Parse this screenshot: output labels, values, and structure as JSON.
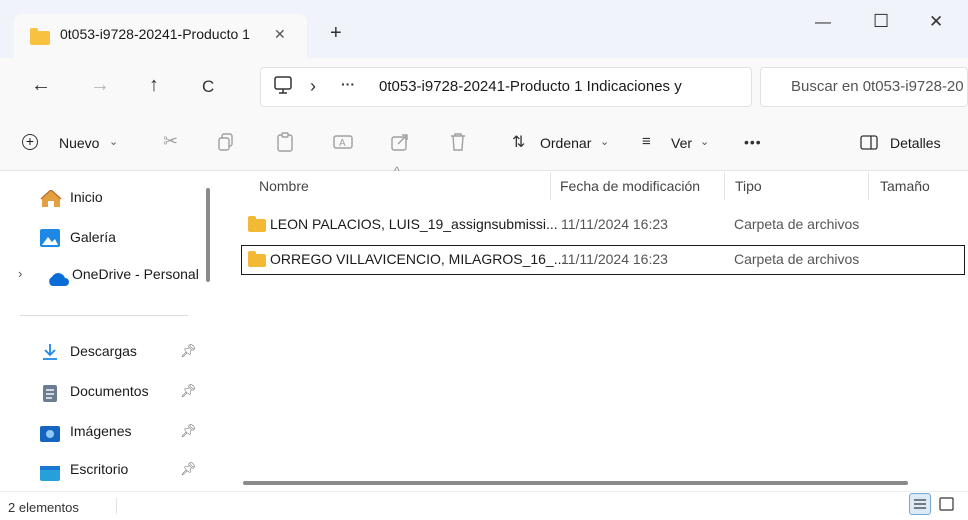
{
  "tab": {
    "title": "0t053-i9728-20241-Producto 1",
    "close": "✕",
    "new_tab": "+"
  },
  "window": {
    "minimize": "—",
    "maximize": "☐",
    "close": "✕"
  },
  "nav": {
    "back": "←",
    "forward": "→",
    "up": "↑",
    "refresh": "C",
    "chevron": "›",
    "more": "···",
    "path": "0t053-i9728-20241-Producto 1 Indicaciones y",
    "search_placeholder": "Buscar en 0t053-i9728-20"
  },
  "toolbar": {
    "new_label": "Nuevo",
    "sort_label": "Ordenar",
    "view_label": "Ver",
    "more": "•••",
    "details_label": "Detalles"
  },
  "sidebar": {
    "items": [
      {
        "label": "Inicio",
        "icon": "home-icon"
      },
      {
        "label": "Galería",
        "icon": "gallery-icon"
      },
      {
        "label": "OneDrive - Personal",
        "icon": "cloud-icon"
      },
      {
        "label": "Descargas",
        "icon": "download-icon",
        "pinned": true
      },
      {
        "label": "Documentos",
        "icon": "documents-icon",
        "pinned": true
      },
      {
        "label": "Imágenes",
        "icon": "pictures-icon",
        "pinned": true
      },
      {
        "label": "Escritorio",
        "icon": "desktop-icon",
        "pinned": true
      }
    ]
  },
  "columns": {
    "name": "Nombre",
    "date": "Fecha de modificación",
    "type": "Tipo",
    "size": "Tamaño"
  },
  "files": [
    {
      "name": "LEON PALACIOS, LUIS_19_assignsubmissi...",
      "date": "11/11/2024 16:23",
      "type": "Carpeta de archivos",
      "size": ""
    },
    {
      "name": "ORREGO VILLAVICENCIO, MILAGROS_16_...",
      "date": "11/11/2024 16:23",
      "type": "Carpeta de archivos",
      "size": ""
    }
  ],
  "status": {
    "count": "2 elementos"
  },
  "colors": {
    "folder": "#f8c140",
    "accent": "#0067c0"
  }
}
